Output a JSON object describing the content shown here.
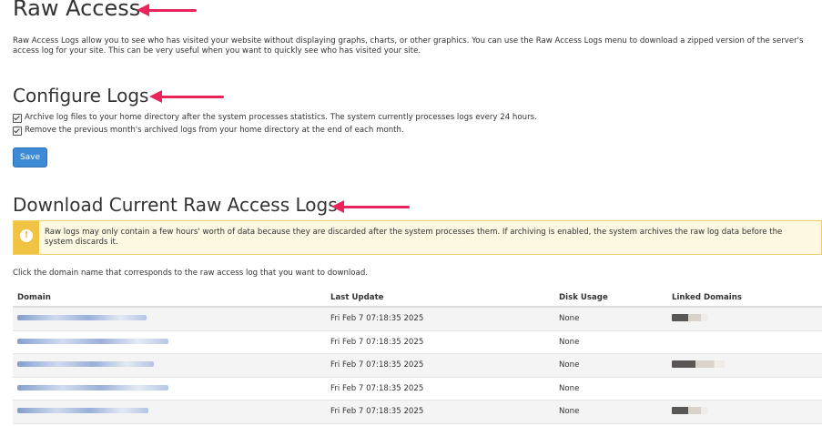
{
  "headings": {
    "raw_access": "Raw Access",
    "configure_logs": "Configure Logs",
    "download_logs": "Download Current Raw Access Logs"
  },
  "intro": "Raw Access Logs allow you to see who has visited your website without displaying graphs, charts, or other graphics. You can use the Raw Access Logs menu to download a zipped version of the server's access log for your site. This can be very useful when you want to quickly see who has visited your site.",
  "configure": {
    "archive_label": "Archive log files to your home directory after the system processes statistics. The system currently processes logs every 24 hours.",
    "archive_checked": true,
    "remove_label": "Remove the previous month's archived logs from your home directory at the end of each month.",
    "remove_checked": true,
    "save_label": "Save"
  },
  "alert": {
    "icon": "exclamation-icon",
    "text": "Raw logs may only contain a few hours' worth of data because they are discarded after the system processes them. If archiving is enabled, the system archives the raw log data before the system discards it."
  },
  "instruction": "Click the domain name that corresponds to the raw access log that you want to download.",
  "table": {
    "headers": [
      "Domain",
      "Last Update",
      "Disk Usage",
      "Linked Domains"
    ],
    "rows": [
      {
        "last_update": "Fri Feb 7 07:18:35 2025",
        "disk_usage": "None"
      },
      {
        "last_update": "Fri Feb 7 07:18:35 2025",
        "disk_usage": "None"
      },
      {
        "last_update": "Fri Feb 7 07:18:35 2025",
        "disk_usage": "None"
      },
      {
        "last_update": "Fri Feb 7 07:18:35 2025",
        "disk_usage": "None"
      },
      {
        "last_update": "Fri Feb 7 07:18:35 2025",
        "disk_usage": "None"
      }
    ]
  },
  "colors": {
    "annotation_arrow": "#e8245b",
    "save_button": "#3d8ad6",
    "alert_stripe": "#f0c342",
    "alert_background": "#fcf8e1"
  }
}
